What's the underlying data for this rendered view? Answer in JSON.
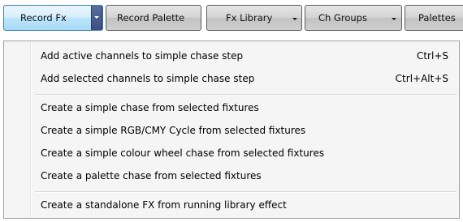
{
  "toolbar": {
    "buttons": [
      {
        "label": "Record  Fx",
        "state": "active"
      },
      {
        "label": "Record Palette"
      },
      {
        "label": "Fx Library"
      },
      {
        "label": "Ch Groups"
      },
      {
        "label": "Palettes"
      }
    ]
  },
  "menu": {
    "items": [
      {
        "label": "Add active channels to simple chase step",
        "shortcut": "Ctrl+S"
      },
      {
        "label": "Add selected channels to simple chase step",
        "shortcut": "Ctrl+Alt+S"
      },
      {
        "label": "Create a simple chase from selected fixtures"
      },
      {
        "label": "Create a simple RGB/CMY Cycle from selected fixtures"
      },
      {
        "label": "Create a simple colour wheel chase from selected fixtures"
      },
      {
        "label": "Create a palette chase from selected fixtures"
      },
      {
        "label": "Create a standalone FX from running library effect"
      }
    ]
  },
  "colors": {
    "active_button": "#bee6fd",
    "button_border": "#5c5c5c",
    "menu_background": "#f5f5f5"
  },
  "icons": {
    "dropdown_arrow": "chevron-down-icon"
  }
}
